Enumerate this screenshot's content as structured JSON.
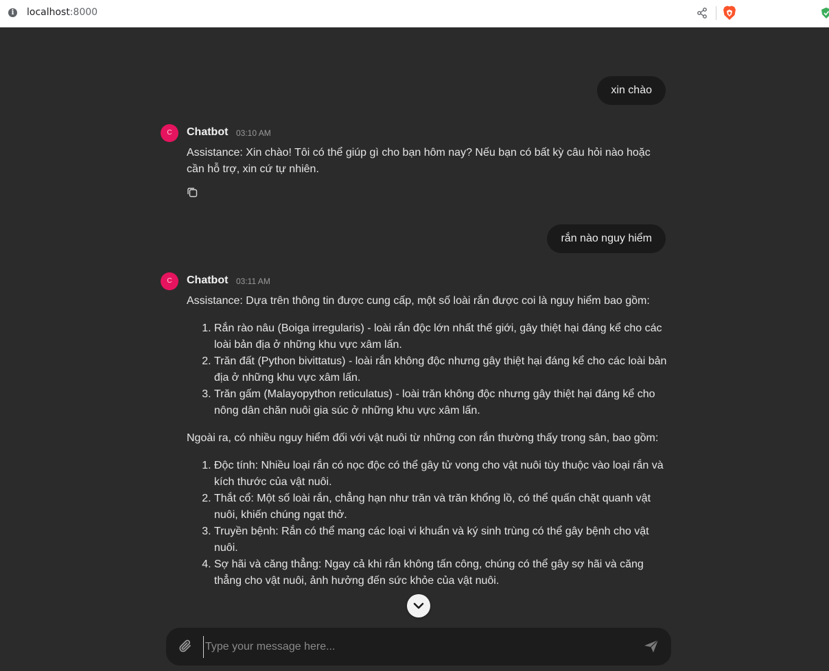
{
  "browser": {
    "url_host": "localhost",
    "url_port": ":8000",
    "icons": [
      "info-icon",
      "share-icon",
      "brave-icon",
      "shield-check-icon"
    ]
  },
  "chat": {
    "messages": [
      {
        "role": "user",
        "text": "xin chào"
      },
      {
        "role": "bot",
        "name": "Chatbot",
        "avatar_letter": "C",
        "time": "03:10 AM",
        "paragraphs": [
          "Assistance: Xin chào! Tôi có thể giúp gì cho bạn hôm nay? Nếu bạn có bất kỳ câu hỏi nào hoặc cần hỗ trợ, xin cứ tự nhiên."
        ]
      },
      {
        "role": "user",
        "text": "rắn nào nguy hiểm"
      },
      {
        "role": "bot",
        "name": "Chatbot",
        "avatar_letter": "C",
        "time": "03:11 AM",
        "intro": "Assistance: Dựa trên thông tin được cung cấp, một số loài rắn được coi là nguy hiểm bao gồm:",
        "list1": [
          "Rắn rào nâu (Boiga irregularis) - loài rắn độc lớn nhất thế giới, gây thiệt hại đáng kể cho các loài bản địa ở những khu vực xâm lấn.",
          "Trăn đất (Python bivittatus) - loài rắn không độc nhưng gây thiệt hại đáng kể cho các loài bản địa ở những khu vực xâm lấn.",
          "Trăn gấm (Malayopython reticulatus) - loài trăn không độc nhưng gây thiệt hại đáng kể cho nông dân chăn nuôi gia súc ở những khu vực xâm lấn."
        ],
        "middle": "Ngoài ra, có nhiều nguy hiểm đối với vật nuôi từ những con rắn thường thấy trong sân, bao gồm:",
        "list2": [
          "Độc tính: Nhiều loại rắn có nọc độc có thể gây tử vong cho vật nuôi tùy thuộc vào loại rắn và kích thước của vật nuôi.",
          "Thắt cổ: Một số loài rắn, chẳng hạn như trăn và trăn khổng lồ, có thể quấn chặt quanh vật nuôi, khiến chúng ngạt thở.",
          "Truyền bệnh: Rắn có thể mang các loại vi khuẩn và ký sinh trùng có thể gây bệnh cho vật nuôi.",
          "Sợ hãi và căng thẳng: Ngay cả khi rắn không tấn công, chúng có thể gây sợ hãi và căng thẳng cho vật nuôi, ảnh hưởng đến sức khỏe của vật nuôi."
        ]
      }
    ]
  },
  "composer": {
    "placeholder": "Type your message here...",
    "value": ""
  },
  "colors": {
    "background": "#2b2b2b",
    "bubble": "#1a1a1a",
    "avatar": "#e6145e",
    "composer": "#1c1c1c"
  }
}
